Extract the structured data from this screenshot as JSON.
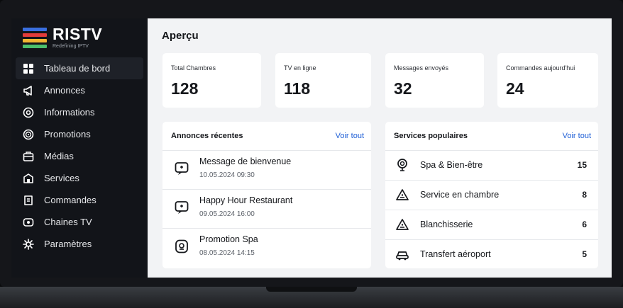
{
  "brand": {
    "name": "RISTV",
    "tagline": "Redefining IPTV",
    "bar_colors": [
      "#3a6fe0",
      "#e23b3b",
      "#f2b632",
      "#4cbf6b"
    ]
  },
  "sidebar": {
    "items": [
      {
        "label": "Tableau de bord",
        "icon": "dashboard-icon",
        "active": true
      },
      {
        "label": "Annonces",
        "icon": "megaphone-icon"
      },
      {
        "label": "Informations",
        "icon": "info-icon"
      },
      {
        "label": "Promotions",
        "icon": "promotion-icon"
      },
      {
        "label": "Médias",
        "icon": "media-icon"
      },
      {
        "label": "Services",
        "icon": "services-icon"
      },
      {
        "label": "Commandes",
        "icon": "orders-icon"
      },
      {
        "label": "Chaines TV",
        "icon": "tv-channels-icon"
      },
      {
        "label": "Paramètres",
        "icon": "settings-icon"
      }
    ]
  },
  "main": {
    "title": "Aperçu",
    "stats": [
      {
        "label": "Total Chambres",
        "value": "128"
      },
      {
        "label": "TV en ligne",
        "value": "118"
      },
      {
        "label": "Messages envoyés",
        "value": "32"
      },
      {
        "label": "Commandes aujourd'hui",
        "value": "24"
      }
    ],
    "announcements": {
      "title": "Annonces récentes",
      "link": "Voir tout",
      "items": [
        {
          "title": "Message de bienvenue",
          "date": "10.05.2024 09:30"
        },
        {
          "title": "Happy Hour Restaurant",
          "date": "09.05.2024 16:00"
        },
        {
          "title": "Promotion Spa",
          "date": "08.05.2024 14:15"
        }
      ]
    },
    "services": {
      "title": "Services populaires",
      "link": "Voir tout",
      "items": [
        {
          "name": "Spa & Bien-être",
          "count": "15",
          "icon": "spa-icon"
        },
        {
          "name": "Service en chambre",
          "count": "8",
          "icon": "room-service-icon"
        },
        {
          "name": "Blanchisserie",
          "count": "6",
          "icon": "laundry-icon"
        },
        {
          "name": "Transfert aéroport",
          "count": "5",
          "icon": "car-icon"
        }
      ]
    }
  },
  "colors": {
    "accent": "#1f5fd6",
    "sidebar_bg": "#121419",
    "main_bg": "#f2f3f5"
  }
}
